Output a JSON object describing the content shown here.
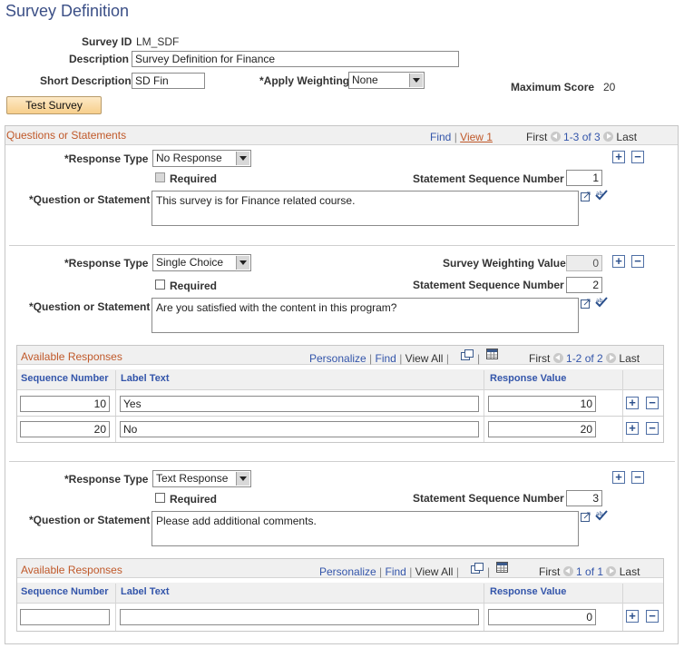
{
  "page": {
    "title": "Survey Definition"
  },
  "header": {
    "survey_id_label": "Survey ID",
    "survey_id_value": "LM_SDF",
    "description_label": "Description",
    "description_value": "Survey Definition for Finance",
    "short_description_label": "Short Description",
    "short_description_value": "SD Fin",
    "apply_weighting_label": "*Apply Weighting",
    "apply_weighting_value": "None",
    "maximum_score_label": "Maximum Score",
    "maximum_score_value": "20",
    "test_survey_button": "Test Survey"
  },
  "questions": {
    "title": "Questions or Statements",
    "find": "Find",
    "view": "View 1",
    "first": "First",
    "range": "1-3 of 3",
    "last": "Last",
    "labels": {
      "response_type": "*Response Type",
      "required": "Required",
      "sequence": "Statement Sequence Number",
      "question": "*Question or Statement",
      "weighting": "Survey Weighting Value"
    },
    "items": [
      {
        "response_type": "No Response",
        "sequence": "1",
        "question": "This survey is for Finance related course."
      },
      {
        "response_type": "Single Choice",
        "weighting": "0",
        "sequence": "2",
        "question": "Are you satisfied with the content in this program?"
      },
      {
        "response_type": "Text Response",
        "sequence": "3",
        "question": "Please add additional comments."
      }
    ]
  },
  "responses_grid": {
    "title": "Available Responses",
    "personalize": "Personalize",
    "find": "Find",
    "view_all": "View All",
    "first": "First",
    "last": "Last",
    "columns": [
      "Sequence Number",
      "Label Text",
      "Response Value"
    ],
    "grid1": {
      "range": "1-2 of 2",
      "rows": [
        {
          "seq": "10",
          "label": "Yes",
          "value": "10"
        },
        {
          "seq": "20",
          "label": "No",
          "value": "20"
        }
      ]
    },
    "grid2": {
      "range": "1 of 1",
      "rows": [
        {
          "seq": "",
          "label": "",
          "value": "0"
        }
      ]
    }
  }
}
